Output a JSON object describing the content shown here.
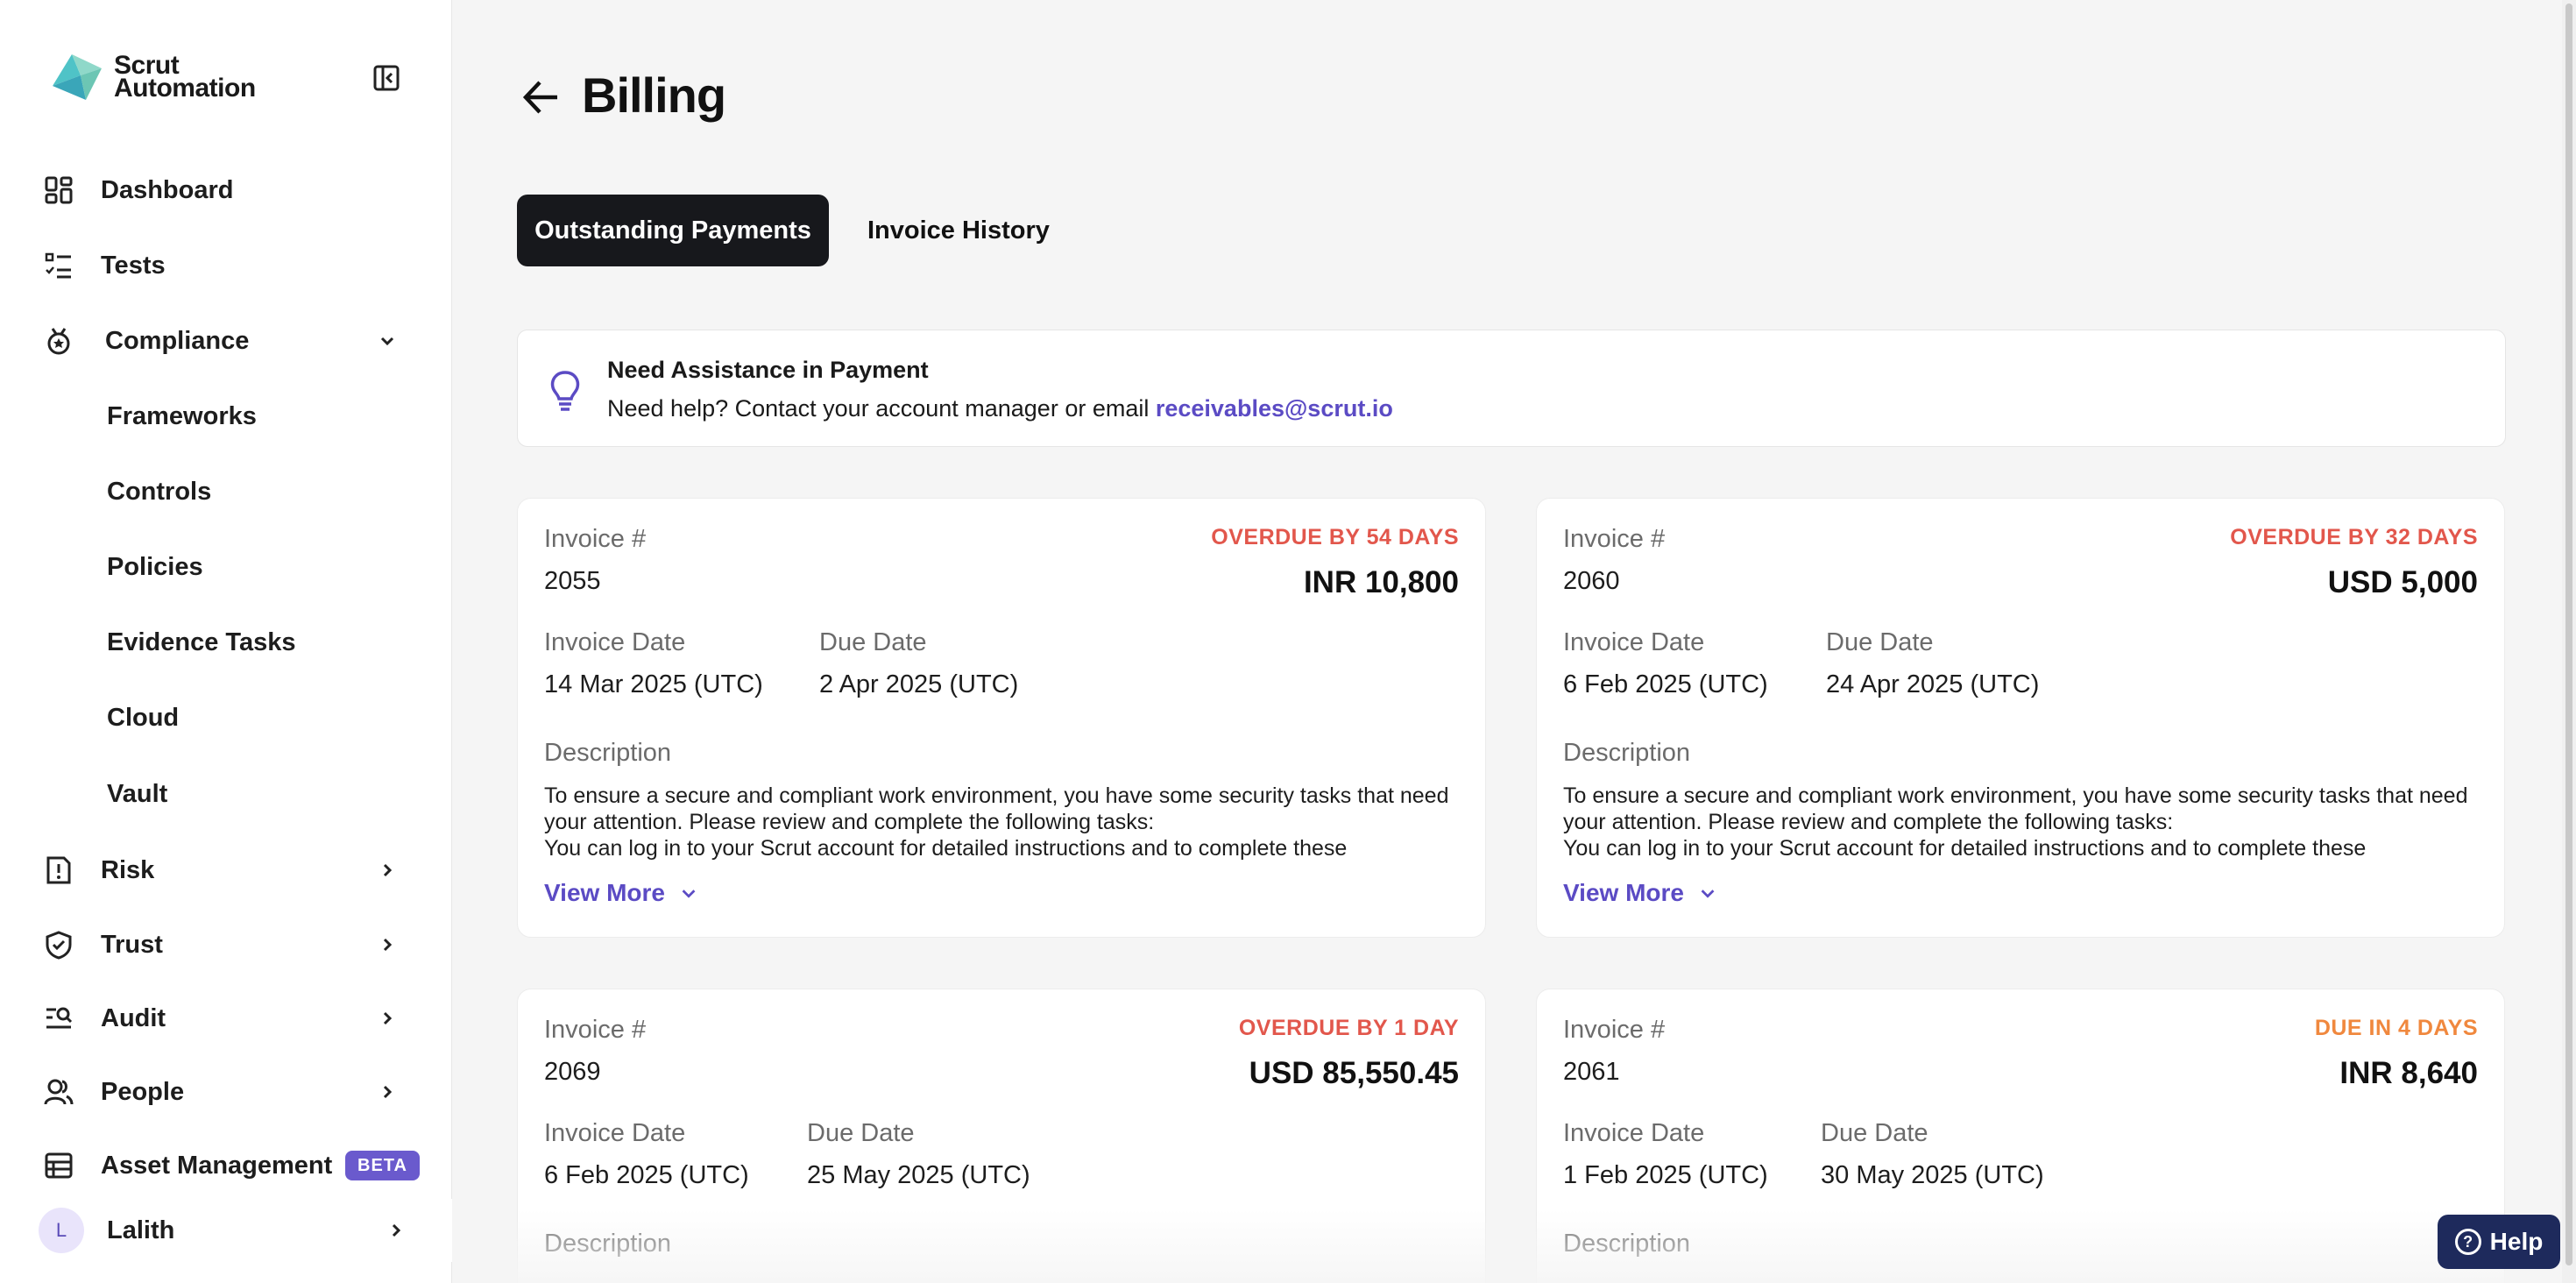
{
  "app": {
    "logo_line1": "Scrut",
    "logo_line2": "Automation"
  },
  "sidebar": {
    "items": [
      {
        "label": "Dashboard"
      },
      {
        "label": "Tests"
      },
      {
        "label": "Compliance"
      },
      {
        "label": "Frameworks"
      },
      {
        "label": "Controls"
      },
      {
        "label": "Policies"
      },
      {
        "label": "Evidence Tasks"
      },
      {
        "label": "Cloud"
      },
      {
        "label": "Vault"
      },
      {
        "label": "Risk"
      },
      {
        "label": "Trust"
      },
      {
        "label": "Audit"
      },
      {
        "label": "People"
      },
      {
        "label": "Asset Management",
        "badge": "BETA"
      }
    ],
    "user": {
      "initial": "L",
      "name": "Lalith"
    }
  },
  "header": {
    "title": "Billing"
  },
  "tabs": [
    {
      "label": "Outstanding Payments",
      "active": true
    },
    {
      "label": "Invoice History",
      "active": false
    }
  ],
  "assistance": {
    "title": "Need Assistance in Payment",
    "text": "Need help? Contact your account manager or email ",
    "email": "receivables@scrut.io"
  },
  "labels": {
    "invoice_number": "Invoice #",
    "invoice_date": "Invoice Date",
    "due_date": "Due Date",
    "description": "Description",
    "view_more": "View More"
  },
  "invoices": [
    {
      "number": "2055",
      "status": "OVERDUE BY 54 DAYS",
      "amount": "INR 10,800",
      "invoice_date": "14 Mar 2025 (UTC)",
      "due_date": "2 Apr 2025 (UTC)",
      "description": "To ensure a secure and compliant work environment, you have some security tasks that need your attention. Please review and complete the following tasks:\nYou can log in to your Scrut account for detailed instructions and to complete these"
    },
    {
      "number": "2060",
      "status": "OVERDUE BY 32 DAYS",
      "amount": "USD 5,000",
      "invoice_date": "6 Feb 2025 (UTC)",
      "due_date": "24 Apr 2025 (UTC)",
      "description": "To ensure a secure and compliant work environment, you have some security tasks that need your attention. Please review and complete the following tasks:\nYou can log in to your Scrut account for detailed instructions and to complete these"
    },
    {
      "number": "2069",
      "status": "OVERDUE BY 1 DAY",
      "amount": "USD 85,550.45",
      "invoice_date": "6 Feb 2025 (UTC)",
      "due_date": "25 May 2025 (UTC)",
      "description": ""
    },
    {
      "number": "2061",
      "status": "DUE IN 4 DAYS",
      "amount": "INR 8,640",
      "invoice_date": "1 Feb 2025 (UTC)",
      "due_date": "30 May 2025 (UTC)",
      "description": ""
    }
  ],
  "help": {
    "label": "Help"
  },
  "colors": {
    "accent": "#5b4bc4",
    "overdue": "#e2574c",
    "due_soon": "#f0883e",
    "active_tab": "#17181c"
  }
}
